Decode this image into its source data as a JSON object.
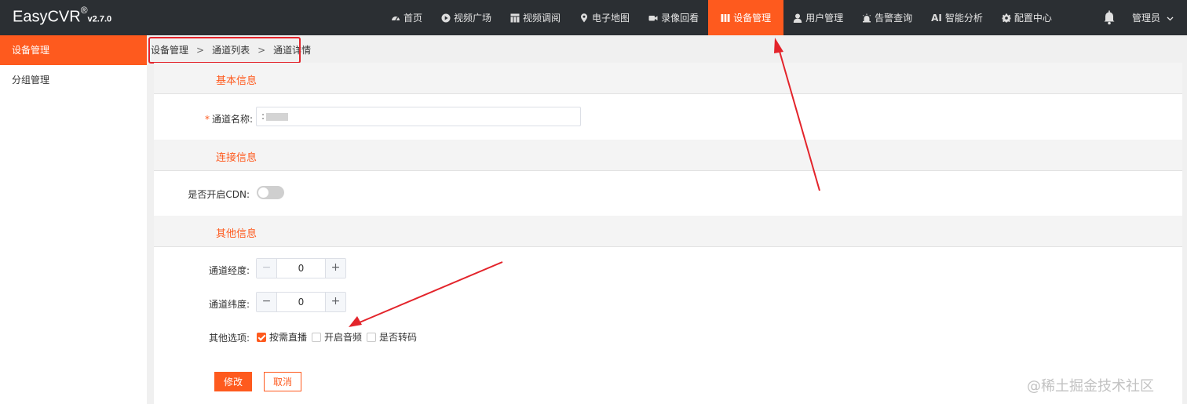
{
  "app": {
    "brand": "EasyCVR",
    "reg": "®",
    "version": "v2.7.0"
  },
  "nav": [
    {
      "label": "首页",
      "icon": "dashboard-icon"
    },
    {
      "label": "视频广场",
      "icon": "play-circle-icon"
    },
    {
      "label": "视频调阅",
      "icon": "grid-layout-icon"
    },
    {
      "label": "电子地图",
      "icon": "map-pin-icon"
    },
    {
      "label": "录像回看",
      "icon": "video-camera-icon"
    },
    {
      "label": "设备管理",
      "icon": "device-columns-icon",
      "active": true
    },
    {
      "label": "用户管理",
      "icon": "user-icon"
    },
    {
      "label": "告警查询",
      "icon": "alarm-icon"
    },
    {
      "label": "智能分析",
      "icon": "ai-icon",
      "icon_text": "AI"
    },
    {
      "label": "配置中心",
      "icon": "gear-icon"
    }
  ],
  "header": {
    "user_label": "管理员"
  },
  "sidebar": {
    "items": [
      {
        "label": "设备管理",
        "active": true
      },
      {
        "label": "分组管理",
        "active": false
      }
    ]
  },
  "breadcrumb": {
    "items": [
      "设备管理",
      "通道列表",
      "通道详情"
    ],
    "separator": ">"
  },
  "sections": {
    "basic": {
      "title": "基本信息",
      "channel_name_label": "通道名称:",
      "required_mark": "*",
      "channel_name_value": ":"
    },
    "connection": {
      "title": "连接信息",
      "cdn_label": "是否开启CDN:",
      "cdn_enabled": false
    },
    "other": {
      "title": "其他信息",
      "longitude_label": "通道经度:",
      "longitude_value": "0",
      "latitude_label": "通道纬度:",
      "latitude_value": "0",
      "options_label": "其他选项:",
      "options": [
        {
          "label": "按需直播",
          "checked": true
        },
        {
          "label": "开启音频",
          "checked": false
        },
        {
          "label": "是否转码",
          "checked": false
        }
      ]
    }
  },
  "actions": {
    "submit_label": "修改",
    "cancel_label": "取消"
  },
  "stepper": {
    "minus": "−",
    "plus": "+"
  },
  "watermark": "@稀土掘金技术社区",
  "colors": {
    "accent": "#fe5a1e",
    "topbar": "#2b2f33",
    "annotation": "#e3242b"
  }
}
